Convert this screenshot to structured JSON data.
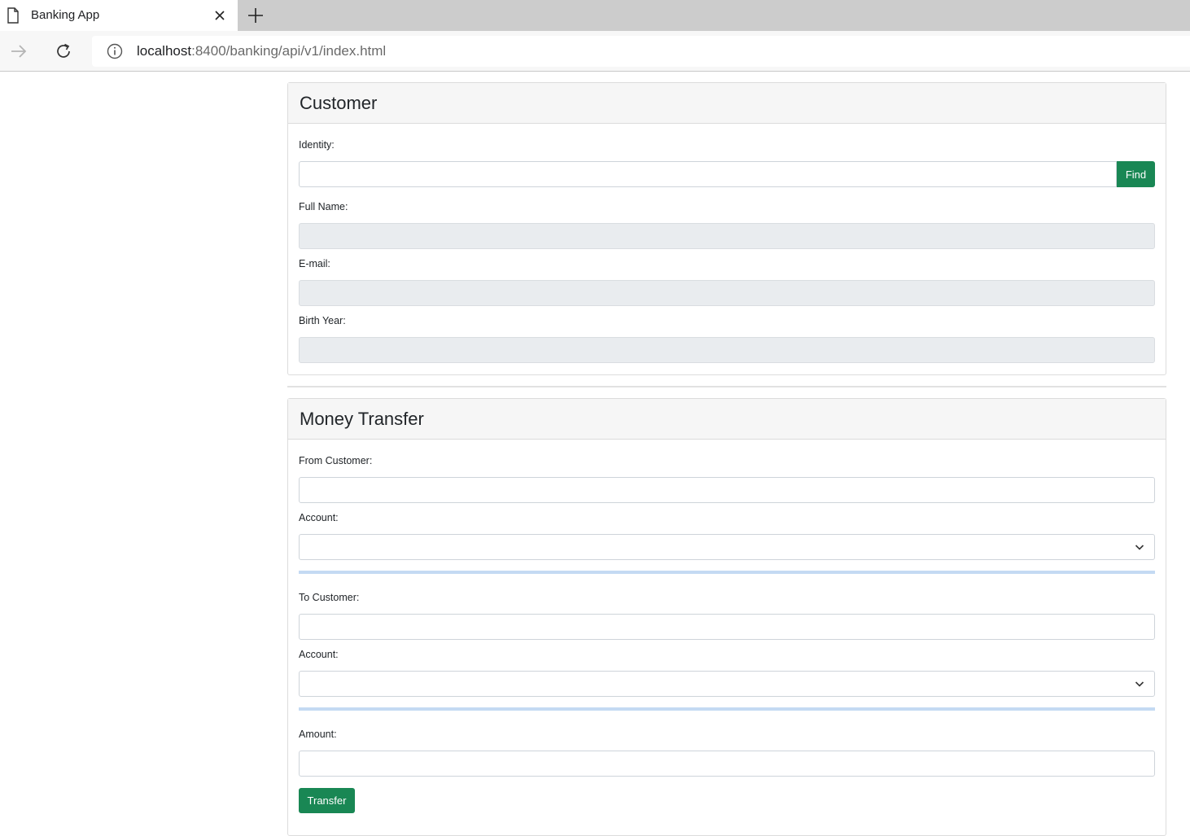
{
  "browser": {
    "tab_title": "Banking App",
    "url_host": "localhost",
    "url_rest": ":8400/banking/api/v1/index.html",
    "icons": {
      "tab": "page-icon",
      "close": "close-icon",
      "new_tab": "plus-icon",
      "forward": "arrow-right-icon",
      "reload": "reload-icon",
      "site_info": "info-icon"
    }
  },
  "customer": {
    "title": "Customer",
    "identity_label": "Identity:",
    "identity_value": "",
    "find_label": "Find",
    "fullname_label": "Full Name:",
    "fullname_value": "",
    "email_label": "E-mail:",
    "email_value": "",
    "birthyear_label": "Birth Year:",
    "birthyear_value": ""
  },
  "transfer": {
    "title": "Money Transfer",
    "from_customer_label": "From Customer:",
    "from_customer_value": "",
    "from_account_label": "Account:",
    "from_account_selected": "",
    "to_customer_label": "To Customer:",
    "to_customer_value": "",
    "to_account_label": "Account:",
    "to_account_selected": "",
    "amount_label": "Amount:",
    "amount_value": "",
    "transfer_label": "Transfer"
  },
  "colors": {
    "primary_button": "#198754",
    "readonly_field": "#e9ecef",
    "accent_line": "#c4daf3"
  }
}
